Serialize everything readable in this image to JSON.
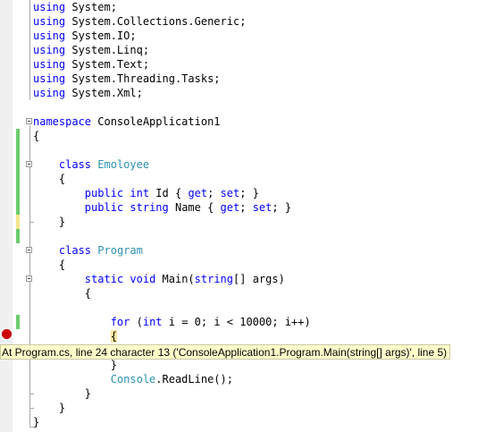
{
  "code": {
    "l0": {
      "kw": "using",
      "text": " System;"
    },
    "l1": {
      "kw": "using",
      "text": " System.Collections.Generic;"
    },
    "l2": {
      "kw": "using",
      "text": " System.IO;"
    },
    "l3": {
      "kw": "using",
      "text": " System.Linq;"
    },
    "l4": {
      "kw": "using",
      "text": " System.Text;"
    },
    "l5": {
      "kw": "using",
      "text": " System.Threading.Tasks;"
    },
    "l6": {
      "kw": "using",
      "text": " System.Xml;"
    },
    "l8": {
      "kw": "namespace",
      "text": " ConsoleApplication1"
    },
    "l9": {
      "text": "{"
    },
    "l11": {
      "indent": "    ",
      "kw": "class",
      "type": "Emoloyee"
    },
    "l12": {
      "text": "    {"
    },
    "l13": {
      "indent": "        ",
      "kw1": "public",
      "kw2": "int",
      "text": " Id { ",
      "kw3": "get",
      "semi1": "; ",
      "kw4": "set",
      "tail": "; }"
    },
    "l14": {
      "indent": "        ",
      "kw1": "public",
      "kw2": "string",
      "text": " Name { ",
      "kw3": "get",
      "semi1": "; ",
      "kw4": "set",
      "tail": "; }"
    },
    "l15": {
      "text": "    }"
    },
    "l17": {
      "indent": "    ",
      "kw": "class",
      "type": "Program"
    },
    "l18": {
      "text": "    {"
    },
    "l19": {
      "indent": "        ",
      "kw1": "static",
      "kw2": "void",
      "text": " Main(",
      "kw3": "string",
      "tail": "[] args)"
    },
    "l20": {
      "text": "        {"
    },
    "l22": {
      "indent": "            ",
      "kw1": "for",
      "text1": " (",
      "kw2": "int",
      "tail": " i = 0; i < 10000; i++)"
    },
    "l23": {
      "indent": "            ",
      "brace": "{"
    },
    "l25": {
      "indent": "            ",
      "text": "}"
    },
    "l26": {
      "indent": "            ",
      "type": "Console",
      "tail": ".ReadLine();"
    },
    "l27": {
      "text": "        }"
    },
    "l28": {
      "text": "    }"
    },
    "l29": {
      "text": "}"
    }
  },
  "tooltip": {
    "text": "At Program.cs, line 24 character 13 ('ConsoleApplication1.Program.Main(string[] args)', line 5)"
  },
  "colors": {
    "keyword": "#0000ff",
    "type": "#2b91af",
    "breakpoint": "#cc0000",
    "change_saved": "#6ccc6c",
    "change_unsaved": "#f3e78a",
    "tooltip_bg": "#ffffcc"
  }
}
